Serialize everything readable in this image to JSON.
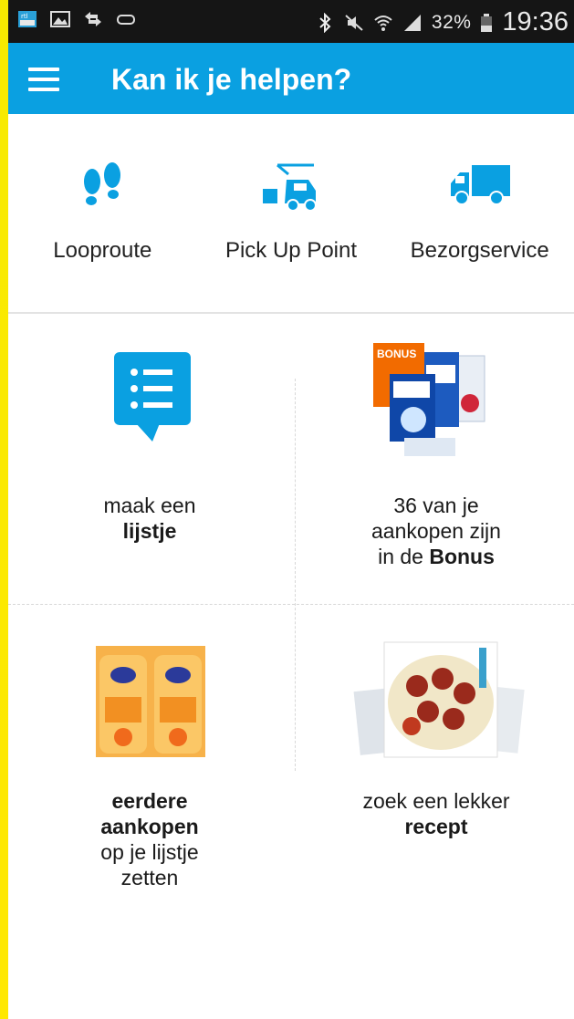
{
  "status_bar": {
    "battery": "32%",
    "time": "19:36"
  },
  "app_bar": {
    "title": "Kan ik je helpen?"
  },
  "quick_actions": [
    {
      "label": "Looproute",
      "icon": "footsteps-icon"
    },
    {
      "label": "Pick Up Point",
      "icon": "pickup-car-icon"
    },
    {
      "label": "Bezorgservice",
      "icon": "delivery-truck-icon"
    }
  ],
  "tiles": {
    "list": {
      "line1": "maak een",
      "line2_bold": "lijstje"
    },
    "bonus": {
      "badge": "BONUS",
      "line1": "36 van je",
      "line2": "aankopen zijn",
      "line3_prefix": "in de",
      "line3_bold": "Bonus"
    },
    "previous": {
      "line1_bold": "eerdere",
      "line2_bold": "aankopen",
      "line3": "op je lijstje",
      "line4": "zetten"
    },
    "recipe": {
      "line1": "zoek een lekker",
      "line2_bold": "recept"
    }
  },
  "colors": {
    "accent": "#0aa0e1",
    "bonus": "#f26b00",
    "frame": "#f2e600"
  }
}
